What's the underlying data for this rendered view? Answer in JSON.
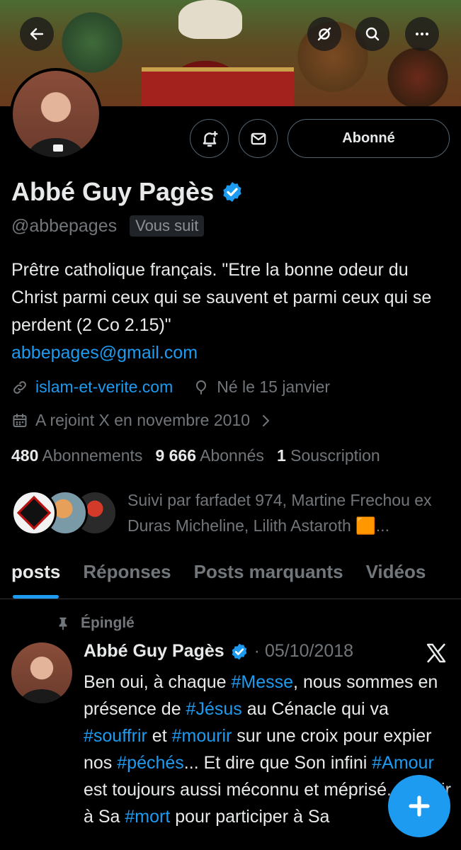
{
  "header": {
    "back_icon": "arrow-left-icon",
    "grok_icon": "grok-icon",
    "search_icon": "search-icon",
    "more_icon": "more-horizontal-icon"
  },
  "profile": {
    "display_name": "Abbé Guy Pagès",
    "handle": "@abbepages",
    "follows_you": "Vous suit",
    "follow_button": "Abonné",
    "bio": "Prêtre catholique français. \"Etre la bonne odeur du Christ parmi ceux qui se sauvent et parmi ceux qui se perdent (2 Co 2.15)\"",
    "email": "abbepages@gmail.com",
    "website": "islam-et-verite.com",
    "birthday": "Né le 15 janvier",
    "joined": "A rejoint X en novembre 2010",
    "stats": {
      "following_count": "480",
      "following_label": "Abonnements",
      "followers_count": "9 666",
      "followers_label": "Abonnés",
      "subs_count": "1",
      "subs_label": "Souscription"
    },
    "followed_by": "Suivi par farfadet 974, Martine Frechou ex Duras Micheline, Lilith Astaroth 🟧..."
  },
  "tabs": [
    {
      "label": "posts"
    },
    {
      "label": "Réponses"
    },
    {
      "label": "Posts marquants"
    },
    {
      "label": "Vidéos"
    }
  ],
  "pinned_post": {
    "pinned_label": "Épinglé",
    "author": "Abbé Guy Pagès",
    "date": "05/10/2018",
    "text_lines": [
      "Ben oui, à chaque ",
      "#Messe",
      ", nous sommes en présence de ",
      "#Jésus",
      " au Cénacle qui va ",
      "#souffrir",
      " et ",
      "#mourir",
      " sur une croix pour expier nos ",
      "#péchés",
      "... Et dire que Son infini ",
      "#Amour",
      " est toujours aussi méconnu et méprisé... S'unir à Sa ",
      "#mort",
      " pour participer à Sa"
    ]
  },
  "colors": {
    "accent": "#1d9bf0",
    "background": "#000000",
    "muted": "#71767b"
  }
}
